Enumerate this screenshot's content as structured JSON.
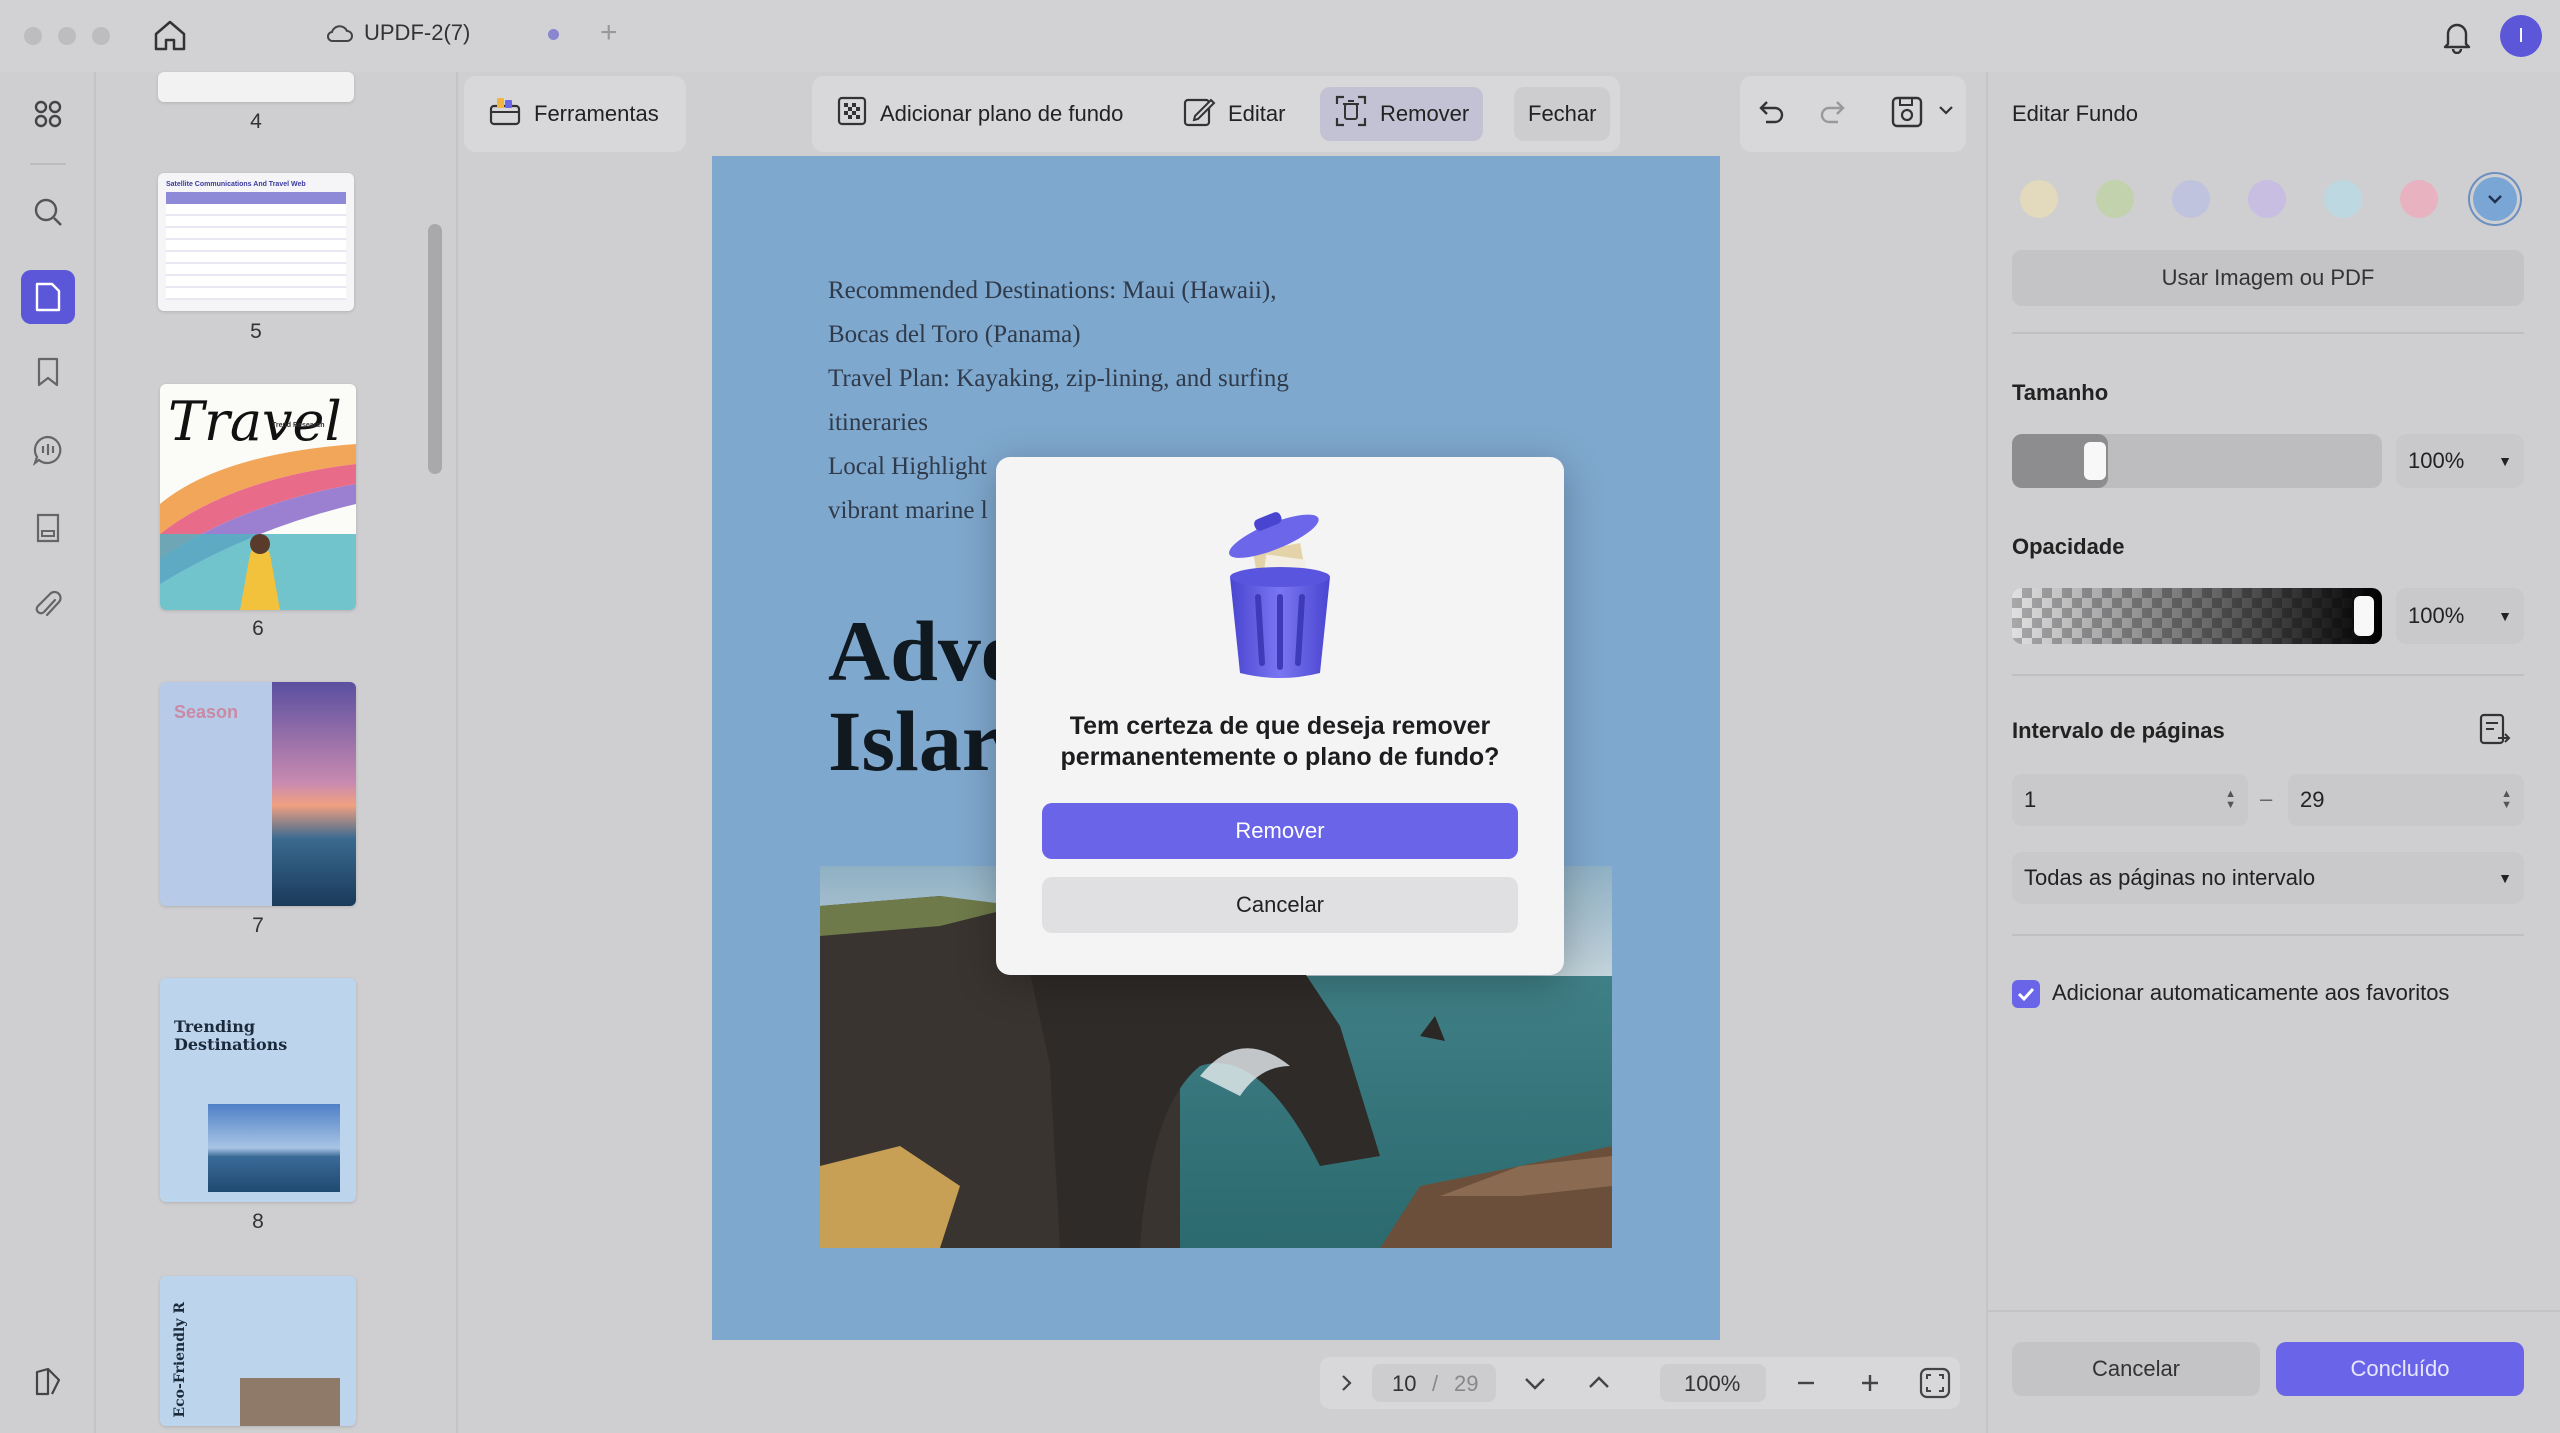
{
  "window": {
    "tab_title": "UPDF-2(7)",
    "user_initial": "I"
  },
  "thumbnails": [
    {
      "num": "4"
    },
    {
      "num": "5"
    },
    {
      "num": "6"
    },
    {
      "num": "7"
    },
    {
      "num": "8"
    }
  ],
  "thumb_text": {
    "p5_header": "Satellite Communications And Travel Web",
    "p6_title": "Travel",
    "p6_sub": "Trend Research",
    "p7_title": "Season",
    "p8_title": "Trending Destinations",
    "p9_title": "Eco-Friendly R"
  },
  "toolbar": {
    "tools_label": "Ferramentas",
    "add_bg_label": "Adicionar plano de fundo",
    "edit_label": "Editar",
    "remove_label": "Remover",
    "close_label": "Fechar"
  },
  "document": {
    "lines": [
      "Recommended Destinations: Maui (Hawaii),",
      "Bocas del Toro (Panama)",
      "Travel Plan: Kayaking, zip-lining, and surfing",
      "itineraries",
      "Local Highlight",
      "vibrant marine l"
    ],
    "heading_line1": "Adve",
    "heading_line2": "Islar"
  },
  "dialog": {
    "message": "Tem certeza de que deseja remover permanentemente o plano de fundo?",
    "confirm_label": "Remover",
    "cancel_label": "Cancelar"
  },
  "bottom_nav": {
    "current_page": "10",
    "separator": "/",
    "total_pages": "29",
    "zoom": "100%"
  },
  "right_panel": {
    "title": "Editar Fundo",
    "swatch_colors": [
      "#e9dcb4",
      "#bcd3a0",
      "#b9bfe0",
      "#c4b8e6",
      "#b8dbe6",
      "#f0a8b9",
      "#7aa6d6"
    ],
    "use_image_label": "Usar Imagem ou PDF",
    "size_label": "Tamanho",
    "size_value": "100%",
    "opacity_label": "Opacidade",
    "opacity_value": "100%",
    "range_label": "Intervalo de páginas",
    "range_from": "1",
    "range_dash": "–",
    "range_to": "29",
    "range_mode": "Todas as páginas no intervalo",
    "favorites_label": "Adicionar automaticamente aos favoritos",
    "cancel_label": "Cancelar",
    "done_label": "Concluído"
  },
  "colors": {
    "accent": "#6a65e8",
    "page_bg": "#7fa8ce"
  }
}
